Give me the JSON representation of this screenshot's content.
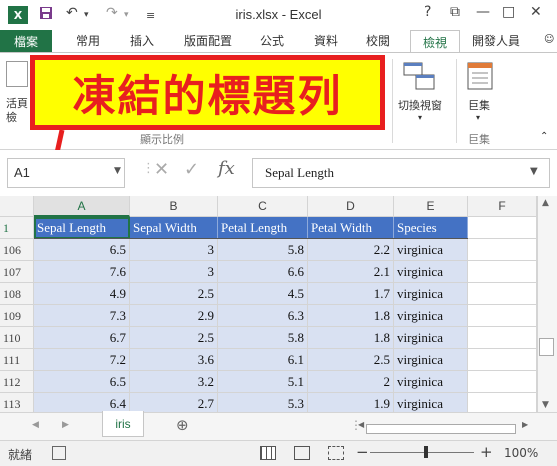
{
  "window": {
    "title": "iris.xlsx - Excel",
    "logo": "X",
    "buttons": [
      "?",
      "⧉",
      "—",
      "□",
      "✕"
    ]
  },
  "quick_access": [
    "save-icon",
    "undo-icon",
    "redo-icon",
    "customize-icon"
  ],
  "tabs": [
    "檔案",
    "常用",
    "插入",
    "版面配置",
    "公式",
    "資料",
    "校閱",
    "檢視",
    "開發人員"
  ],
  "active_tab": "檢視",
  "ribbon": {
    "left_labels": [
      "活頁",
      "檢"
    ],
    "switch_windows": "切換視窗",
    "macros": "巨集",
    "macros_group": "巨集",
    "partial_group": "顯示比例"
  },
  "callout": "凍結的標題列",
  "formula_bar": {
    "name_box": "A1",
    "fx": "fx",
    "content": "Sepal Length"
  },
  "columns": [
    "A",
    "B",
    "C",
    "D",
    "E",
    "F"
  ],
  "header_row": {
    "row": "1",
    "cells": [
      "Sepal Length",
      "Sepal Width",
      "Petal Length",
      "Petal Width",
      "Species"
    ]
  },
  "rows": [
    {
      "row": "106",
      "cells": [
        "6.5",
        "3",
        "5.8",
        "2.2",
        "virginica"
      ]
    },
    {
      "row": "107",
      "cells": [
        "7.6",
        "3",
        "6.6",
        "2.1",
        "virginica"
      ]
    },
    {
      "row": "108",
      "cells": [
        "4.9",
        "2.5",
        "4.5",
        "1.7",
        "virginica"
      ]
    },
    {
      "row": "109",
      "cells": [
        "7.3",
        "2.9",
        "6.3",
        "1.8",
        "virginica"
      ]
    },
    {
      "row": "110",
      "cells": [
        "6.7",
        "2.5",
        "5.8",
        "1.8",
        "virginica"
      ]
    },
    {
      "row": "111",
      "cells": [
        "7.2",
        "3.6",
        "6.1",
        "2.5",
        "virginica"
      ]
    },
    {
      "row": "112",
      "cells": [
        "6.5",
        "3.2",
        "5.1",
        "2",
        "virginica"
      ]
    },
    {
      "row": "113",
      "cells": [
        "6.4",
        "2.7",
        "5.3",
        "1.9",
        "virginica"
      ]
    }
  ],
  "sheet_tab": "iris",
  "status": {
    "ready": "就緒",
    "zoom": "100%"
  }
}
